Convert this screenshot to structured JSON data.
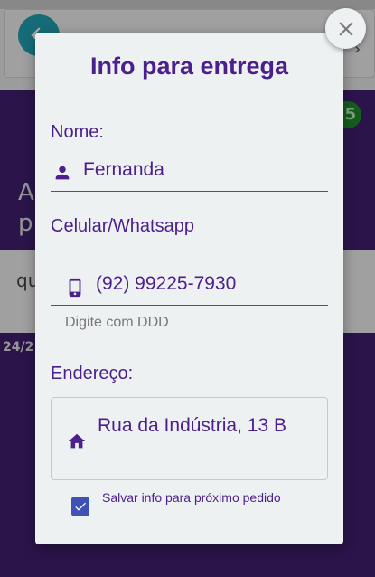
{
  "background": {
    "card_text_a": "A",
    "card_text_p": "p",
    "card2_text": "qu",
    "date_fragment": "24/2",
    "badge": "5"
  },
  "modal": {
    "title": "Info para entrega",
    "name": {
      "label": "Nome:",
      "value": "Fernanda"
    },
    "phone": {
      "label": "Celular/Whatsapp",
      "value": "(92) 99225-7930",
      "hint": "Digite com DDD"
    },
    "address": {
      "label": "Endereço:",
      "value": "Rua da Indústria, 13 B"
    },
    "save_option": {
      "label": "Salvar info para próximo pedido",
      "checked": true
    }
  },
  "colors": {
    "accent": "#4b1f8c",
    "checkbox": "#3f51b5",
    "background": "#3f1e6e"
  },
  "icons": {
    "back": "arrow-left-icon",
    "close": "close-icon",
    "person": "person-icon",
    "phone": "smartphone-icon",
    "home": "home-icon",
    "check": "check-icon"
  }
}
